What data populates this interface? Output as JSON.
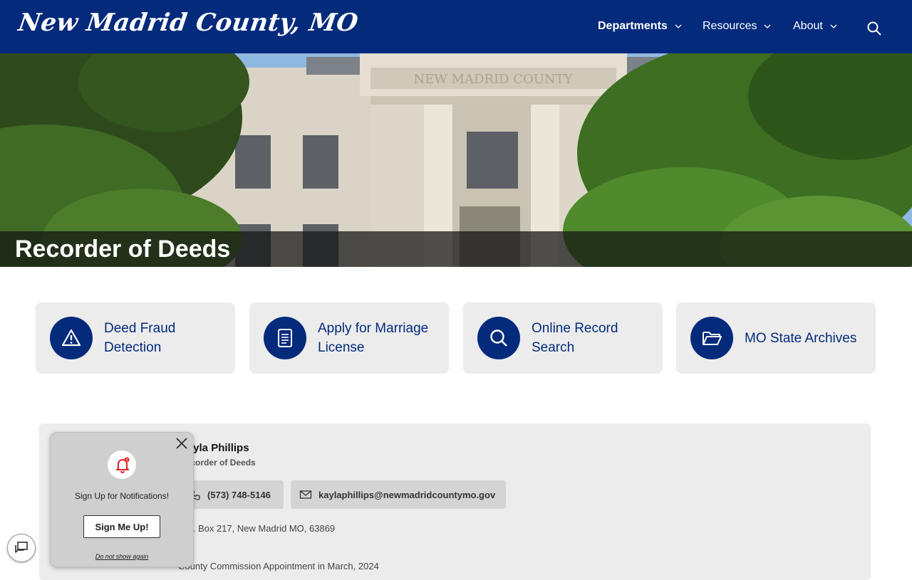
{
  "header": {
    "logo": "New Madrid County, MO",
    "nav": [
      "Departments",
      "Resources",
      "About"
    ],
    "background": "#042a7c"
  },
  "hero": {
    "title": "Recorder of Deeds",
    "building_inscription": "NEW MADRID COUNTY"
  },
  "quick_links": [
    {
      "label": "Deed Fraud Detection",
      "icon": "warning-icon"
    },
    {
      "label": "Apply for Marriage License",
      "icon": "document-icon"
    },
    {
      "label": "Online Record Search",
      "icon": "search-icon"
    },
    {
      "label": "MO State Archives",
      "icon": "folder-icon"
    }
  ],
  "contact": {
    "name": "Kayla Phillips",
    "role": "Recorder of Deeds",
    "phone": "(573) 748-5146",
    "email": "kaylaphillips@newmadridcountymo.gov",
    "address": "P.O. Box 217, New Madrid MO, 63869",
    "note": "County Commission Appointment in March, 2024"
  },
  "popup": {
    "text": "Sign Up for Notifications!",
    "button": "Sign Me Up!",
    "dismiss": "Do not show again"
  },
  "colors": {
    "brand": "#042a7c",
    "card": "#ececec",
    "alert": "#e0242a"
  }
}
